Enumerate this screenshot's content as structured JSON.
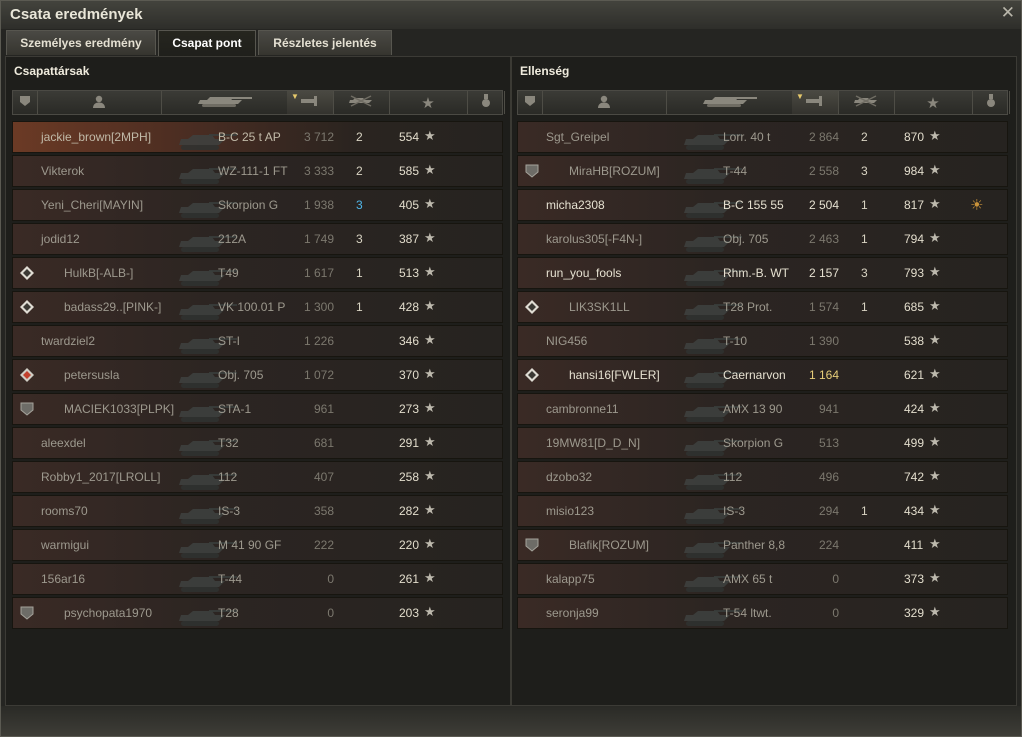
{
  "window": {
    "title": "Csata eredmények",
    "close_glyph": "✕"
  },
  "tabs": [
    {
      "label": "Személyes eredmény",
      "active": false
    },
    {
      "label": "Csapat pont",
      "active": true
    },
    {
      "label": "Részletes jelentés",
      "active": false
    }
  ],
  "columns": [
    {
      "icon": "squad-icon"
    },
    {
      "icon": "player-icon"
    },
    {
      "icon": "tank-icon"
    },
    {
      "icon": "damage-icon",
      "sorted": true
    },
    {
      "icon": "kills-icon"
    },
    {
      "icon": "experience-star-icon"
    },
    {
      "icon": "medal-icon"
    }
  ],
  "allies": {
    "title": "Csapattársak",
    "rows": [
      {
        "name": "jackie_brown[2MPH]",
        "tank": "B-C 25 t AP",
        "damage": "3 712",
        "kills": "2",
        "xp": "554",
        "me": true
      },
      {
        "name": "Vikterok",
        "tank": "WZ-111-1 FT",
        "damage": "3 333",
        "kills": "2",
        "xp": "585"
      },
      {
        "name": "Yeni_Cheri[MAYIN]",
        "tank": "Skorpion G",
        "damage": "1 938",
        "kills": "3",
        "xp": "405",
        "kill_color": "blue"
      },
      {
        "name": "jodid12",
        "tank": "212A",
        "damage": "1 749",
        "kills": "3",
        "xp": "387"
      },
      {
        "name": "HulkB[-ALB-]",
        "tank": "T49",
        "damage": "1 617",
        "kills": "1",
        "xp": "513",
        "badge": "diamond"
      },
      {
        "name": "badass29..[PINK-]",
        "tank": "VK 100.01 P",
        "damage": "1 300",
        "kills": "1",
        "xp": "428",
        "badge": "diamond"
      },
      {
        "name": "twardziel2",
        "tank": "ST-I",
        "damage": "1 226",
        "kills": "",
        "xp": "346"
      },
      {
        "name": "petersusla",
        "tank": "Obj. 705",
        "damage": "1 072",
        "kills": "",
        "xp": "370",
        "badge": "diamond-red"
      },
      {
        "name": "MACIEK1033[PLPK]",
        "tank": "STA-1",
        "damage": "961",
        "kills": "",
        "xp": "273",
        "badge": "shield"
      },
      {
        "name": "aleexdel",
        "tank": "T32",
        "damage": "681",
        "kills": "",
        "xp": "291"
      },
      {
        "name": "Robby1_2017[LROLL]",
        "tank": "112",
        "damage": "407",
        "kills": "",
        "xp": "258"
      },
      {
        "name": "rooms70",
        "tank": "IS-3",
        "damage": "358",
        "kills": "",
        "xp": "282"
      },
      {
        "name": "warmigui",
        "tank": "M 41 90 GF",
        "damage": "222",
        "kills": "",
        "xp": "220"
      },
      {
        "name": "156ar16",
        "tank": "T-44",
        "damage": "0",
        "kills": "",
        "xp": "261"
      },
      {
        "name": "psychopata1970",
        "tank": "T28",
        "damage": "0",
        "kills": "",
        "xp": "203",
        "badge": "shield"
      }
    ]
  },
  "enemies": {
    "title": "Ellenség",
    "rows": [
      {
        "name": "Sgt_Greipel",
        "tank": "Lorr. 40 t",
        "damage": "2 864",
        "kills": "2",
        "xp": "870"
      },
      {
        "name": "MiraHB[ROZUM]",
        "tank": "T-44",
        "damage": "2 558",
        "kills": "3",
        "xp": "984",
        "badge": "shield"
      },
      {
        "name": "micha2308",
        "tank": "B-C 155 55",
        "damage": "2 504",
        "kills": "1",
        "xp": "817",
        "medal": "☀",
        "bright": true
      },
      {
        "name": "karolus305[-F4N-]",
        "tank": "Obj. 705",
        "damage": "2 463",
        "kills": "1",
        "xp": "794"
      },
      {
        "name": "run_you_fools",
        "tank": "Rhm.-B. WT",
        "damage": "2 157",
        "kills": "3",
        "xp": "793",
        "bright": true
      },
      {
        "name": "LIK3SK1LL",
        "tank": "T28 Prot.",
        "damage": "1 574",
        "kills": "1",
        "xp": "685",
        "badge": "diamond"
      },
      {
        "name": "NIG456",
        "tank": "T-10",
        "damage": "1 390",
        "kills": "",
        "xp": "538"
      },
      {
        "name": "hansi16[FWLER]",
        "tank": "Caernarvon",
        "damage": "1 164",
        "kills": "",
        "xp": "621",
        "badge": "diamond",
        "bright": true,
        "gold": true
      },
      {
        "name": "cambronne11",
        "tank": "AMX 13 90",
        "damage": "941",
        "kills": "",
        "xp": "424"
      },
      {
        "name": "19MW81[D_D_N]",
        "tank": "Skorpion G",
        "damage": "513",
        "kills": "",
        "xp": "499"
      },
      {
        "name": "dzobo32",
        "tank": "112",
        "damage": "496",
        "kills": "",
        "xp": "742"
      },
      {
        "name": "misio123",
        "tank": "IS-3",
        "damage": "294",
        "kills": "1",
        "xp": "434"
      },
      {
        "name": "Blafik[ROZUM]",
        "tank": "Panther 8,8",
        "damage": "224",
        "kills": "",
        "xp": "411",
        "badge": "shield"
      },
      {
        "name": "kalapp75",
        "tank": "AMX 65 t",
        "damage": "0",
        "kills": "",
        "xp": "373"
      },
      {
        "name": "seronja99",
        "tank": "T-54 ltwt.",
        "damage": "0",
        "kills": "",
        "xp": "329"
      }
    ]
  },
  "star_glyph": "★"
}
